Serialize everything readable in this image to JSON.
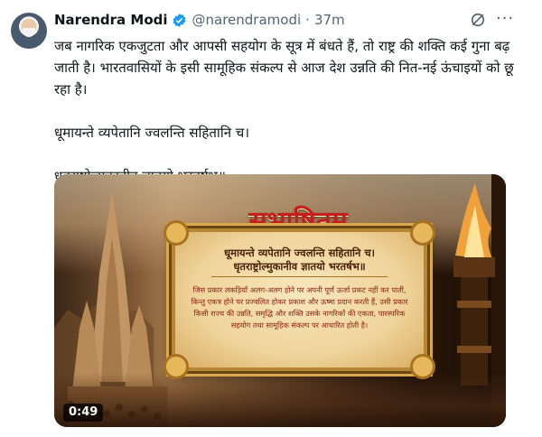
{
  "author": {
    "name": "Narendra Modi",
    "handle": "@narendramodi",
    "separator": "·",
    "time": "37m"
  },
  "icons": {
    "verified": "verified-badge-icon",
    "grok": "grok-icon",
    "more": "more-options-icon"
  },
  "colors": {
    "verified": "#1d9bf0",
    "banner_red": "#c41f1c",
    "meaning_text": "#8a1f10"
  },
  "post": {
    "paragraph1": "जब नागरिक एकजुटता और आपसी सहयोग के सूत्र में बंधते हैं, तो राष्ट्र की शक्ति कई गुना बढ़ जाती है। भारतवासियों के इसी सामूहिक संकल्प से आज देश उन्नति की नित-नई ऊंचाइयों को छू रहा है।",
    "paragraph2": "धूमायन्ते व्यपेतानि ज्वलन्ति सहितानि च।",
    "paragraph3": "धृतराष्ट्रोल्मुकानीव ज्ञातयो भरतर्षभ॥"
  },
  "more_label": "···",
  "media": {
    "banner_title": "सुभाषितम्",
    "sloka_line1": "धूमायन्ते व्यपेतानि ज्वलन्ति सहितानि च।",
    "sloka_line2": "धृतराष्ट्रोल्मुकानीव ज्ञातयो भरतर्षभ॥",
    "meaning": "जिस प्रकार लकड़ियाँ अलग-अलग होने पर अपनी पूर्ण ऊर्जा प्रकट नहीं कर पातीं, किन्तु एकत्र होने पर प्रज्वलित होकर प्रकाश और ऊष्मा प्रदान करती हैं, उसी प्रकार किसी राज्य की उन्नति, समृद्धि और शक्ति उसके नागरिकों की एकता, पारस्परिक सहयोग तथा सामूहिक संकल्प पर आधारित होती है।",
    "duration": "0:49"
  }
}
